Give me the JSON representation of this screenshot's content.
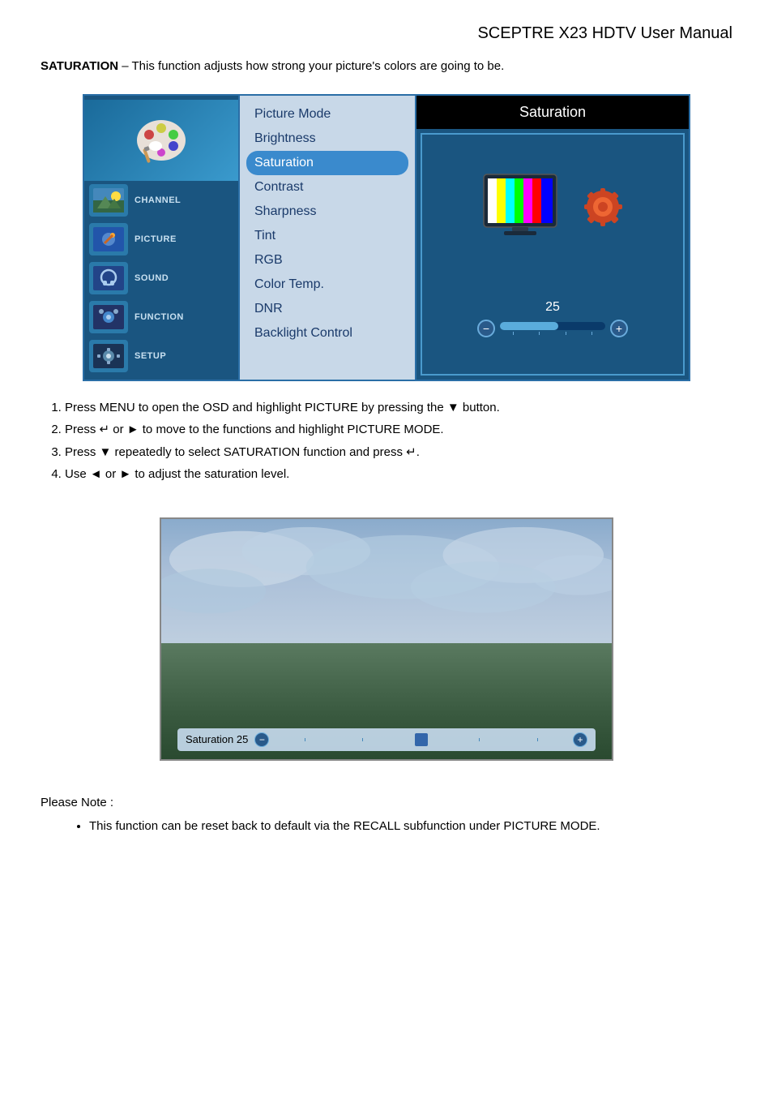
{
  "header": {
    "title": "SCEPTRE X23 HDTV User Manual"
  },
  "intro": {
    "bold": "SATURATION",
    "text": " – This function adjusts how strong your picture's colors are going to be."
  },
  "osd": {
    "sidebar_items": [
      {
        "label": "CHANNEL",
        "icon": "📷"
      },
      {
        "label": "PICTURE",
        "icon": "🔧"
      },
      {
        "label": "SOUND",
        "icon": "🎵"
      },
      {
        "label": "FUNCTION",
        "icon": "⚙"
      },
      {
        "label": "SETUP",
        "icon": "⚙"
      }
    ],
    "menu_items": [
      {
        "label": "Picture Mode",
        "selected": false
      },
      {
        "label": "Brightness",
        "selected": false
      },
      {
        "label": "Saturation",
        "selected": true
      },
      {
        "label": "Contrast",
        "selected": false
      },
      {
        "label": "Sharpness",
        "selected": false
      },
      {
        "label": "Tint",
        "selected": false
      },
      {
        "label": "RGB",
        "selected": false
      },
      {
        "label": "Color Temp.",
        "selected": false
      },
      {
        "label": "DNR",
        "selected": false
      },
      {
        "label": "Backlight Control",
        "selected": false
      }
    ],
    "right_title": "Saturation",
    "slider_value": "25",
    "minus_label": "−",
    "plus_label": "+"
  },
  "instructions": [
    "Press MENU to open the OSD and highlight PICTURE by pressing the ▼ button.",
    "Press ↵ or ► to move to the functions and highlight PICTURE MODE.",
    "Press ▼ repeatedly to select SATURATION function and press ↵.",
    "Use ◄ or ► to adjust the saturation level."
  ],
  "photo_slider": {
    "label": "Saturation 25",
    "minus": "−",
    "plus": "+"
  },
  "note": {
    "title": "Please Note :",
    "bullets": [
      "This function can be reset back to default via the RECALL subfunction under PICTURE MODE."
    ]
  }
}
